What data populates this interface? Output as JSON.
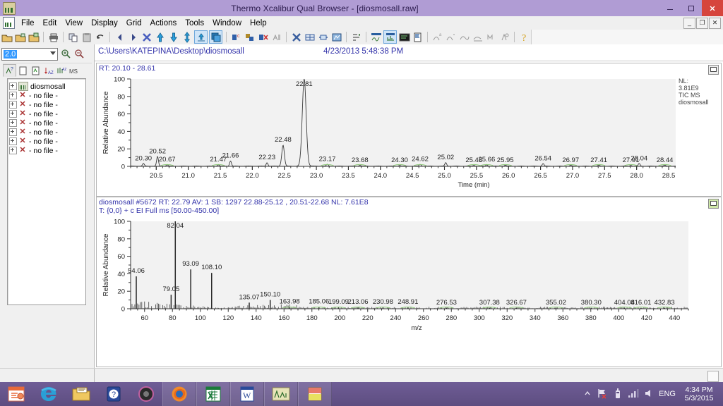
{
  "window": {
    "title": "Thermo Xcalibur Qual Browser - [diosmosall.raw]",
    "app_icon": "spectrum-document-icon",
    "minimize": "minimize-icon",
    "maximize": "restore-icon",
    "close": "close-icon"
  },
  "menubar": {
    "items": [
      "File",
      "Edit",
      "View",
      "Display",
      "Grid",
      "Actions",
      "Tools",
      "Window",
      "Help"
    ],
    "mdi_buttons": [
      "_",
      "❐",
      "✕"
    ]
  },
  "toolbar": {
    "icons": [
      "open-folder-icon",
      "open-raw-folder-icon",
      "open-sequence-folder-icon",
      "print-icon",
      "copy-icon",
      "paste-icon",
      "undo-icon",
      "previous-scan-icon",
      "next-scan-icon",
      "full-range-icon",
      "scan-up-icon",
      "scan-down-icon",
      "scan-both-icon",
      "normalize-icon",
      "layout-grid-icon",
      "subtract-spectrum-icon",
      "add-spectrum-icon",
      "delete-spectrum-icon",
      "library-search-icon",
      "zoom-reset-icon",
      "grid-cells-icon",
      "center-icon",
      "full-screen-icon",
      "ranges-icon",
      "chromatogram-icon",
      "spectrum-icon",
      "map-icon",
      "report-icon",
      "peak-detect-icon",
      "peak-integrate-icon",
      "smooth-icon",
      "baseline-icon",
      "mass-range-icon",
      "qual-process-icon",
      "help-icon"
    ],
    "selected": [
      "normalize-icon",
      "layout-grid-icon",
      "spectrum-icon"
    ]
  },
  "left_panel": {
    "zoom_combo": {
      "value": "2.0",
      "arrow": "chevron-down-icon"
    },
    "zoom_in_icon": "zoom-in-icon",
    "zoom_out_icon": "zoom-out-icon",
    "tabs": [
      "info-icon",
      "page-icon",
      "sample-icon",
      "az-sort-icon",
      "az-filter-icon",
      "ms-icon"
    ],
    "tree": [
      {
        "label": "diosmosall",
        "icon": "spectrum-file-icon"
      },
      {
        "label": "- no file -",
        "icon": "no-file-icon"
      },
      {
        "label": "- no file -",
        "icon": "no-file-icon"
      },
      {
        "label": "- no file -",
        "icon": "no-file-icon"
      },
      {
        "label": "- no file -",
        "icon": "no-file-icon"
      },
      {
        "label": "- no file -",
        "icon": "no-file-icon"
      },
      {
        "label": "- no file -",
        "icon": "no-file-icon"
      },
      {
        "label": "- no file -",
        "icon": "no-file-icon"
      }
    ]
  },
  "document": {
    "path": "C:\\Users\\KATEPINA\\Desktop\\diosmosall",
    "datetime": "4/23/2013 5:48:38 PM"
  },
  "chromatogram_pane": {
    "header": "RT:  20.10 - 28.61",
    "nl_label": "NL:",
    "nl_value": "3.81E9",
    "nl_type": "TIC  MS",
    "nl_sample": "diosmosall",
    "expand_button": "pane-expand-icon"
  },
  "spectrum_pane": {
    "header_line1": "diosmosall #5672  RT: 22.79  AV: 1  SB: 1297  22.88-25.12 , 20.51-22.68  NL: 7.61E8",
    "header_line2": "T: {0,0}  + c EI Full ms [50.00-450.00]",
    "expand_button": "pane-expand-icon"
  },
  "statusbar": {
    "resize_grip": "resize-grip-icon"
  },
  "taskbar": {
    "items": [
      {
        "name": "powerpoint-icon",
        "label": "PowerPoint",
        "open": false
      },
      {
        "name": "internet-explorer-icon",
        "label": "Internet Explorer",
        "open": false
      },
      {
        "name": "file-explorer-icon",
        "label": "File Explorer",
        "open": false
      },
      {
        "name": "help-support-icon",
        "label": "Help",
        "open": false
      },
      {
        "name": "media-player-icon",
        "label": "Media Player",
        "open": false
      },
      {
        "name": "firefox-icon",
        "label": "Firefox",
        "open": true
      },
      {
        "name": "excel-icon",
        "label": "Excel",
        "open": true
      },
      {
        "name": "word-icon",
        "label": "Word",
        "open": true
      },
      {
        "name": "xcalibur-icon",
        "label": "Xcalibur Qual Browser",
        "open": true
      },
      {
        "name": "xcalibur-doc-icon",
        "label": "Xcalibur",
        "open": true
      }
    ],
    "tray": {
      "show_hidden": "chevron-up-icon",
      "network": "network-flag-icon",
      "usb": "usb-device-icon",
      "signal": "signal-bars-icon",
      "volume": "speaker-icon",
      "language": "ENG",
      "time": "4:34 PM",
      "date": "5/3/2015"
    }
  },
  "colors": {
    "title_bar": "#b09cd4",
    "close_button": "#d6453d",
    "label_blue": "#3333aa",
    "taskbar": "#6f5d96",
    "selection_blue": "#3399ff",
    "plot_bg": "#f2f2f2",
    "trace": "#3a3a3a",
    "highlight_green": "#8fc97a"
  },
  "chart_data": [
    {
      "type": "line",
      "id": "chromatogram",
      "title": "RT:  20.10 - 28.61",
      "xlabel": "Time (min)",
      "ylabel": "Relative Abundance",
      "xlim": [
        20.1,
        28.61
      ],
      "ylim": [
        0,
        100
      ],
      "xticks": [
        20.5,
        21.0,
        21.5,
        22.0,
        22.5,
        23.0,
        23.5,
        24.0,
        24.5,
        25.0,
        25.5,
        26.0,
        26.5,
        27.0,
        27.5,
        28.0,
        28.5
      ],
      "yticks": [
        0,
        20,
        40,
        60,
        80,
        100
      ],
      "grid": false,
      "nl": "3.81E9",
      "nl_type": "TIC MS diosmosall",
      "peaks": [
        {
          "rt": 20.3,
          "height": 3,
          "label": "20.30"
        },
        {
          "rt": 20.52,
          "height": 11,
          "label": "20.52"
        },
        {
          "rt": 20.67,
          "height": 1.5,
          "label": "20.67"
        },
        {
          "rt": 21.47,
          "height": 1.5,
          "label": "21.47"
        },
        {
          "rt": 21.66,
          "height": 6,
          "label": "21.66"
        },
        {
          "rt": 22.23,
          "height": 4,
          "label": "22.23"
        },
        {
          "rt": 22.48,
          "height": 24,
          "label": "22.48"
        },
        {
          "rt": 22.81,
          "height": 100,
          "label": "22.81"
        },
        {
          "rt": 23.17,
          "height": 2,
          "label": "23.17"
        },
        {
          "rt": 23.68,
          "height": 1,
          "label": "23.68"
        },
        {
          "rt": 24.3,
          "height": 1,
          "label": "24.30"
        },
        {
          "rt": 24.62,
          "height": 2,
          "label": "24.62"
        },
        {
          "rt": 25.02,
          "height": 4,
          "label": "25.02"
        },
        {
          "rt": 25.46,
          "height": 1,
          "label": "25.46"
        },
        {
          "rt": 25.66,
          "height": 1.5,
          "label": "25.66"
        },
        {
          "rt": 25.95,
          "height": 1,
          "label": "25.95"
        },
        {
          "rt": 26.54,
          "height": 3,
          "label": "26.54"
        },
        {
          "rt": 26.97,
          "height": 1,
          "label": "26.97"
        },
        {
          "rt": 27.41,
          "height": 1,
          "label": "27.41"
        },
        {
          "rt": 27.91,
          "height": 1,
          "label": "27.91"
        },
        {
          "rt": 28.04,
          "height": 3,
          "label": "28.04"
        },
        {
          "rt": 28.44,
          "height": 1,
          "label": "28.44"
        }
      ]
    },
    {
      "type": "bar",
      "id": "mass-spectrum",
      "title": "diosmosall #5672  RT: 22.79  AV: 1  SB: 1297  22.88-25.12 , 20.51-22.68  NL: 7.61E8",
      "subtitle": "T: {0,0}  + c EI Full ms [50.00-450.00]",
      "xlabel": "m/z",
      "ylabel": "Relative Abundance",
      "xlim": [
        50,
        450
      ],
      "ylim": [
        0,
        100
      ],
      "xticks": [
        60,
        80,
        100,
        120,
        140,
        160,
        180,
        200,
        220,
        240,
        260,
        280,
        300,
        320,
        340,
        360,
        380,
        400,
        420,
        440
      ],
      "yticks": [
        0,
        20,
        40,
        60,
        80,
        100
      ],
      "grid": false,
      "nl": "7.61E8",
      "labeled_peaks": [
        {
          "mz": 54.06,
          "intensity": 37,
          "label": "54.06"
        },
        {
          "mz": 79.05,
          "intensity": 16,
          "label": "79.05"
        },
        {
          "mz": 82.04,
          "intensity": 100,
          "label": "82.04"
        },
        {
          "mz": 93.09,
          "intensity": 45,
          "label": "93.09"
        },
        {
          "mz": 108.1,
          "intensity": 41,
          "label": "108.10"
        },
        {
          "mz": 135.07,
          "intensity": 7,
          "label": "135.07"
        },
        {
          "mz": 150.1,
          "intensity": 10,
          "label": "150.10"
        },
        {
          "mz": 163.98,
          "intensity": 2,
          "label": "163.98"
        },
        {
          "mz": 185.06,
          "intensity": 2,
          "label": "185.06"
        },
        {
          "mz": 199.09,
          "intensity": 1.5,
          "label": "199.09"
        },
        {
          "mz": 213.06,
          "intensity": 1.5,
          "label": "213.06"
        },
        {
          "mz": 230.98,
          "intensity": 1.5,
          "label": "230.98"
        },
        {
          "mz": 248.91,
          "intensity": 1.5,
          "label": "248.91"
        },
        {
          "mz": 276.53,
          "intensity": 1,
          "label": "276.53"
        },
        {
          "mz": 307.38,
          "intensity": 1,
          "label": "307.38"
        },
        {
          "mz": 326.67,
          "intensity": 1,
          "label": "326.67"
        },
        {
          "mz": 355.02,
          "intensity": 1,
          "label": "355.02"
        },
        {
          "mz": 380.3,
          "intensity": 1,
          "label": "380.30"
        },
        {
          "mz": 404.08,
          "intensity": 1,
          "label": "404.08"
        },
        {
          "mz": 416.01,
          "intensity": 1,
          "label": "416.01"
        },
        {
          "mz": 432.83,
          "intensity": 1,
          "label": "432.83"
        }
      ]
    }
  ]
}
